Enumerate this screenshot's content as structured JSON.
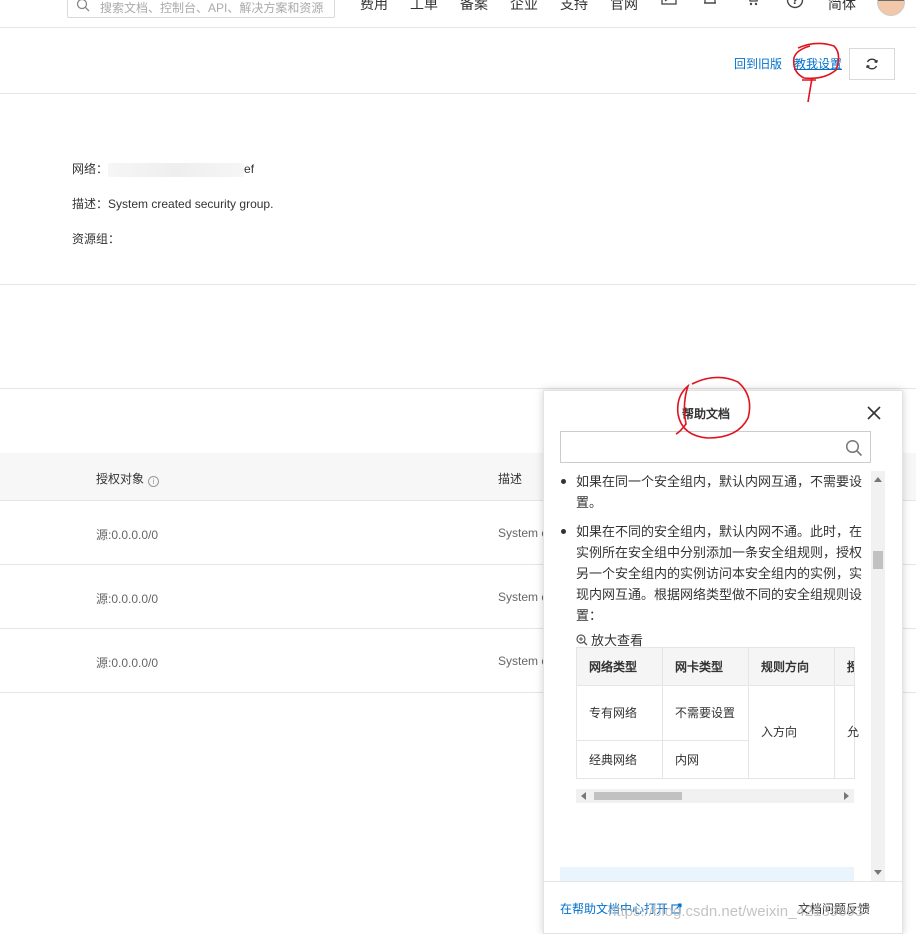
{
  "topbar": {
    "search_placeholder": "搜索文档、控制台、API、解决方案和资源",
    "nav": [
      "费用",
      "工单",
      "备案",
      "企业",
      "支持",
      "官网"
    ],
    "lang": "简体"
  },
  "header": {
    "back_old": "回到旧版",
    "teach_me": "教我设置"
  },
  "info": {
    "network_label": "网络：",
    "network_suffix": "ef",
    "desc_label": "描述：",
    "desc_value": "System created security group.",
    "resource_group_label": "资源组："
  },
  "table": {
    "col_auth": "授权对象",
    "col_desc": "描述",
    "rows": [
      {
        "auth": "源:0.0.0.0/0",
        "desc": "System c"
      },
      {
        "auth": "源:0.0.0.0/0",
        "desc": "System c"
      },
      {
        "auth": "源:0.0.0.0/0",
        "desc": "System c"
      }
    ]
  },
  "help": {
    "title": "帮助文档",
    "bullet1": "如果在同一个安全组内，默认内网互通，不需要设置。",
    "bullet2": "如果在不同的安全组内，默认内网不通。此时，在实例所在安全组中分别添加一条安全组规则，授权另一个安全组内的实例访问本安全组内的实例，实现内网互通。根据网络类型做不同的安全组规则设置：",
    "zoom": "放大查看",
    "headers": [
      "网络类型",
      "网卡类型",
      "规则方向",
      "授"
    ],
    "rows": [
      {
        "net": "专有网络",
        "nic": "不需要设置"
      },
      {
        "net": "经典网络",
        "nic": "内网"
      }
    ],
    "direction": "入方向",
    "cut_cell": "允",
    "open_in_center": "在帮助文档中心打开",
    "feedback": "文档问题反馈"
  },
  "watermark": "https://blog.csdn.net/weixin_42139693"
}
